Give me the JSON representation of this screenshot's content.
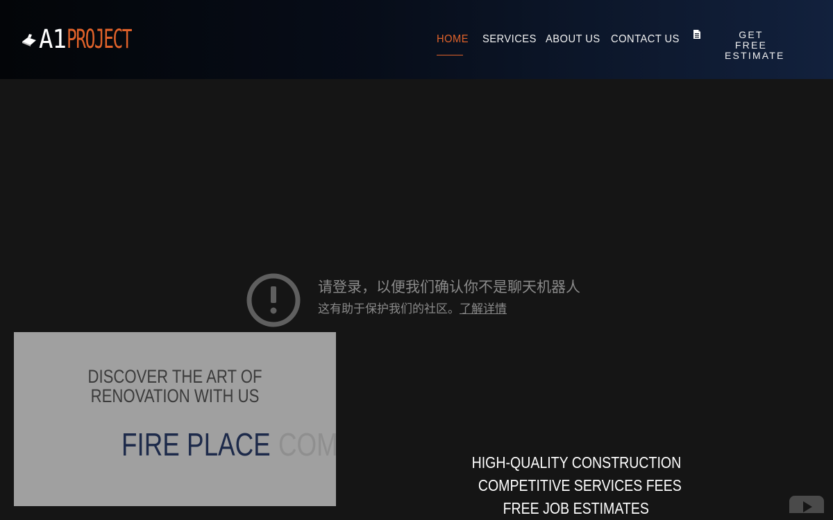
{
  "header": {
    "logo": {
      "part1": "A1",
      "part2": "PROJECT",
      "icon": "trowel-icon"
    },
    "nav": [
      {
        "label": "HOME",
        "active": true
      },
      {
        "label": "SERVICES",
        "active": false
      },
      {
        "label": "ABOUT US",
        "active": false
      },
      {
        "label": "CONTACT US",
        "active": false
      }
    ],
    "estimate": {
      "icon": "document-icon",
      "line1": "GET FREE",
      "line2": "ESTIMATE"
    }
  },
  "captcha": {
    "icon": "exclamation-circle-icon",
    "title": "请登录，以便我们确认你不是聊天机器人",
    "subtitle": "这有助于保护我们的社区。",
    "link": "了解详情"
  },
  "promo": {
    "heading": "DISCOVER THE ART OF RENOVATION WITH US",
    "rotating_words": [
      "FIRE PLACE",
      "COMERC"
    ]
  },
  "features": [
    "HIGH-QUALITY CONSTRUCTION",
    "COMPETITIVE SERVICES FEES",
    "FREE JOB ESTIMATES"
  ],
  "video": {
    "icon": "youtube-play-icon"
  },
  "colors": {
    "accent": "#e0622a",
    "header_bg_start": "#030508",
    "header_bg_end": "#12213d",
    "page_bg": "#151515",
    "promo_bg": "#a0a0a0",
    "rotator_active": "#1d2a4a"
  }
}
